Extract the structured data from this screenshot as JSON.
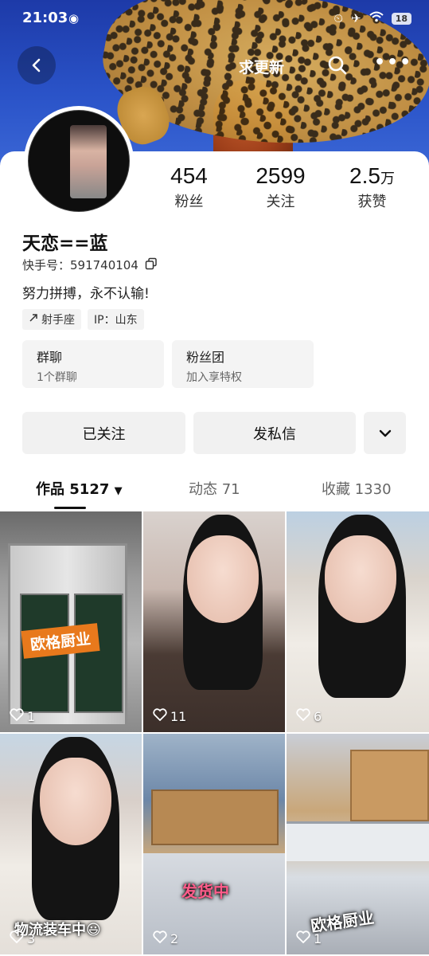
{
  "status": {
    "time": "21:03",
    "battery": "18"
  },
  "nav": {
    "title": "求更新"
  },
  "profile": {
    "name": "天恋==蓝",
    "id_label": "快手号：591740104",
    "bio": "努力拼搏，永不认输!",
    "tags": [
      "射手座",
      "IP：山东"
    ],
    "stats": [
      {
        "num": "454",
        "unit": "",
        "label": "粉丝"
      },
      {
        "num": "2599",
        "unit": "",
        "label": "关注"
      },
      {
        "num": "2.5",
        "unit": "万",
        "label": "获赞"
      }
    ]
  },
  "features": [
    {
      "title": "群聊",
      "sub": "1个群聊"
    },
    {
      "title": "粉丝团",
      "sub": "加入享特权"
    }
  ],
  "actions": {
    "follow": "已关注",
    "message": "发私信"
  },
  "tabs": [
    {
      "label": "作品 5127"
    },
    {
      "label": "动态 71"
    },
    {
      "label": "收藏 1330"
    }
  ],
  "grid": [
    {
      "likes": "1",
      "overlay": "欧格厨业"
    },
    {
      "likes": "11",
      "overlay": ""
    },
    {
      "likes": "6",
      "overlay": ""
    },
    {
      "likes": "3",
      "overlay": "物流装车中😃"
    },
    {
      "likes": "2",
      "overlay": "发货中"
    },
    {
      "likes": "1",
      "overlay": "欧格厨业"
    }
  ]
}
